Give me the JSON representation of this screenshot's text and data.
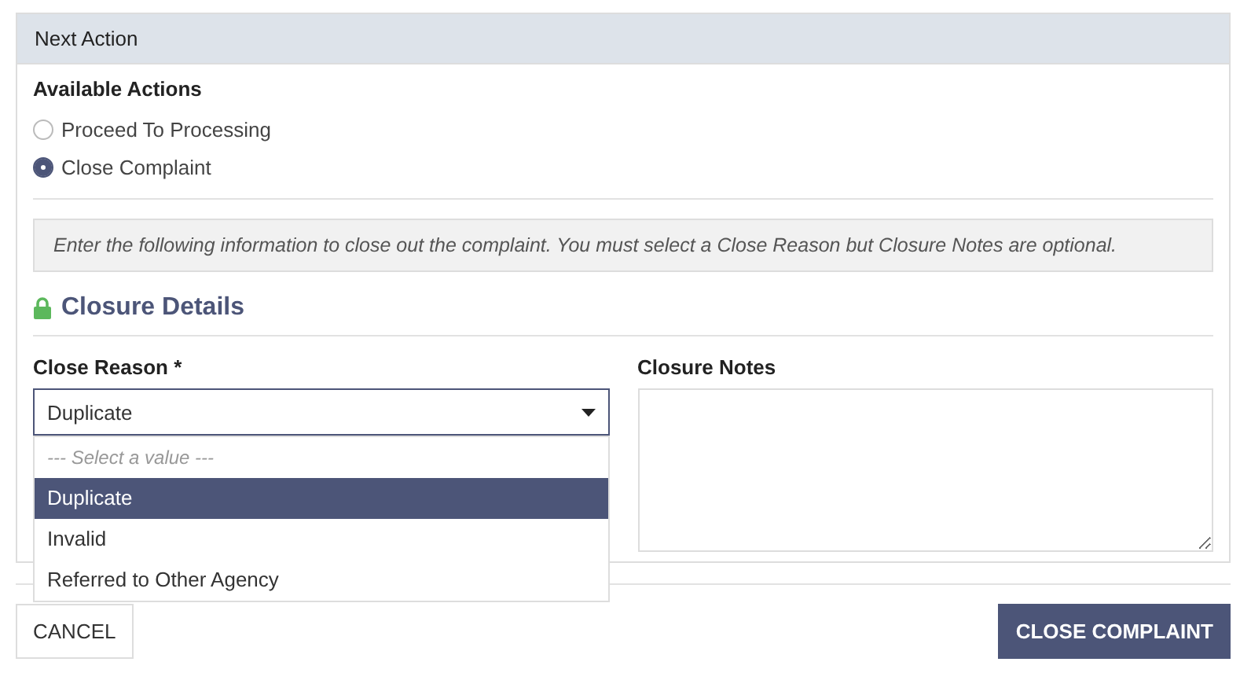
{
  "panel": {
    "title": "Next Action"
  },
  "actions": {
    "label": "Available Actions",
    "options": [
      {
        "label": "Proceed To Processing",
        "selected": false
      },
      {
        "label": "Close Complaint",
        "selected": true
      }
    ]
  },
  "info": "Enter the following information to close out the complaint. You must select a Close Reason but Closure Notes are optional.",
  "section": {
    "title": "Closure Details"
  },
  "close_reason": {
    "label": "Close Reason",
    "required_mark": "*",
    "value": "Duplicate",
    "expanded": true,
    "options": [
      {
        "label": "--- Select a value ---",
        "kind": "placeholder",
        "selected": false
      },
      {
        "label": "Duplicate",
        "kind": "option",
        "selected": true
      },
      {
        "label": "Invalid",
        "kind": "option",
        "selected": false
      },
      {
        "label": "Referred to Other Agency",
        "kind": "option",
        "selected": false
      }
    ]
  },
  "closure_notes": {
    "label": "Closure Notes"
  },
  "buttons": [
    {
      "label": "CANCEL",
      "kind": "secondary"
    },
    {
      "label": "CLOSE COMPLAINT",
      "kind": "primary"
    }
  ]
}
